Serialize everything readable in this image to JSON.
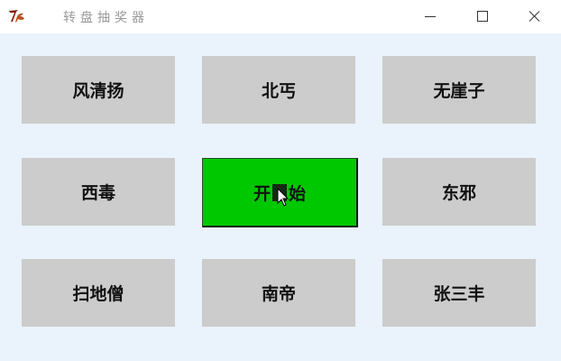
{
  "window": {
    "title": "转盘抽奖器",
    "app_icon": "tk-feather-icon",
    "controls": [
      "minimize-icon",
      "maximize-icon",
      "close-icon"
    ]
  },
  "grid": {
    "cells": [
      {
        "label": "风清扬"
      },
      {
        "label": "北丐"
      },
      {
        "label": "无崖子"
      },
      {
        "label": "西毒"
      },
      {
        "label": "东邪"
      },
      {
        "label": "扫地僧"
      },
      {
        "label": "南帝"
      },
      {
        "label": "张三丰"
      }
    ],
    "start_button": {
      "label_left": "开",
      "label_right": "始",
      "color": "#00c800"
    },
    "cell_color": "#cccccc",
    "background": "#eaf2fc"
  }
}
